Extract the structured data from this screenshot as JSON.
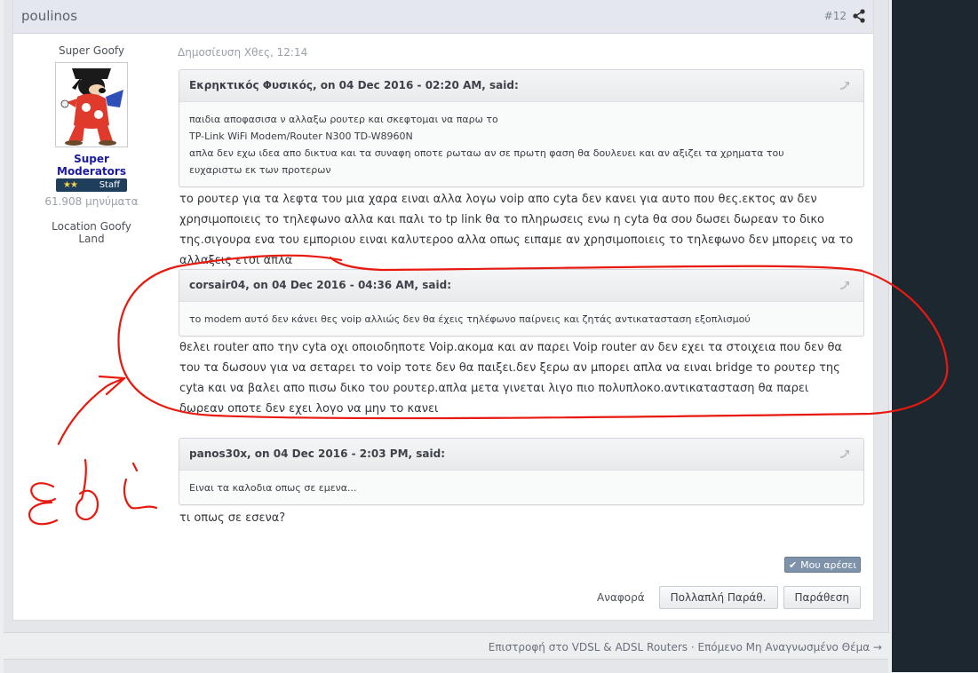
{
  "post": {
    "author": "poulinos",
    "number": "#12",
    "date": "Δημοσίευση Χθες, 12:14"
  },
  "user": {
    "title": "Super Goofy",
    "group": "Super Moderators",
    "badge": "Staff",
    "badge_stars": "★★",
    "posts": "61.908 μηνύματα",
    "location": "Location Goofy Land"
  },
  "quotes": [
    {
      "who": "Εκρηκτικός Φυσικός, on 04 Dec 2016 - 02:20 AM, said:",
      "lines": [
        "παιδια αποφασισα ν αλλαξω ρουτερ και σκεφτομαι να παρω το",
        "TP-Link WiFi Modem/Router N300 TD-W8960N",
        "απλα δεν εχω ιδεα απο δικτυα και τα συναφη οποτε ρωταω αν σε πρωτη φαση θα δουλευει και αν αξιζει τα χρηματα του",
        "ευχαριστω εκ των προτερων"
      ]
    },
    {
      "who": "corsair04, on 04 Dec 2016 - 04:36 AM, said:",
      "lines": [
        "το modem αυτό δεν κάνει θες voip αλλιώς δεν θα έχεις τηλέφωνο παίρνεις και ζητάς αντικατασταση εξοπλισμού"
      ]
    },
    {
      "who": "panos30x, on 04 Dec 2016 - 2:03 PM, said:",
      "lines": [
        "Ειναι τα καλοδια οπως σε εμενα..."
      ]
    }
  ],
  "replies": [
    "το ρουτερ για τα λεφτα του μια χαρα ειναι αλλα λογω voip απο cyta δεν κανει για αυτο που θες.εκτος αν δεν χρησιμοποιεις το τηλεφωνο αλλα και παλι  το tp link θα το πληρωσεις ενω η cyta θα σου δωσει δωρεαν το δικο της.σιγουρα ενα του εμποριου ειναι καλυτεροο αλλα οπως ειπαμε αν χρησιμοποιεις το τηλεφωνο δεν μπορεις να το αλλαξεις ετσι απλα",
    "θελει router απο την cyta οχι οποιοδηποτε Voip.ακομα και αν παρει Voip router αν δεν εχει τα στοιχεια  που δεν θα του τα δωσουν για να σεταρει το voip τοτε δεν θα παιξει.δεν ξερω αν μπορει απλα να ειναι bridge το ρουτερ της cyta και να βαλει απο πισω δικο του ρουτερ.απλα μετα γινεται λιγο πιο πολυπλοκο.αντικατασταση θα παρει δωρεαν οποτε δεν εχει λογο να μην το κανει",
    "τι οπως σε εσενα?"
  ],
  "actions": {
    "like": "Μου αρέσει",
    "report": "Αναφορά",
    "multiquote": "Πολλαπλή Παράθ.",
    "quote": "Παράθεση"
  },
  "bottom_nav": "Επιστροφή στο VDSL & ADSL Routers · Επόμενο Μη Αναγνωσμένο Θέμα →",
  "colors": {
    "annotation": "#e8190f",
    "group_link": "#1a1aa0",
    "header_bg": "#e4e8ee"
  }
}
